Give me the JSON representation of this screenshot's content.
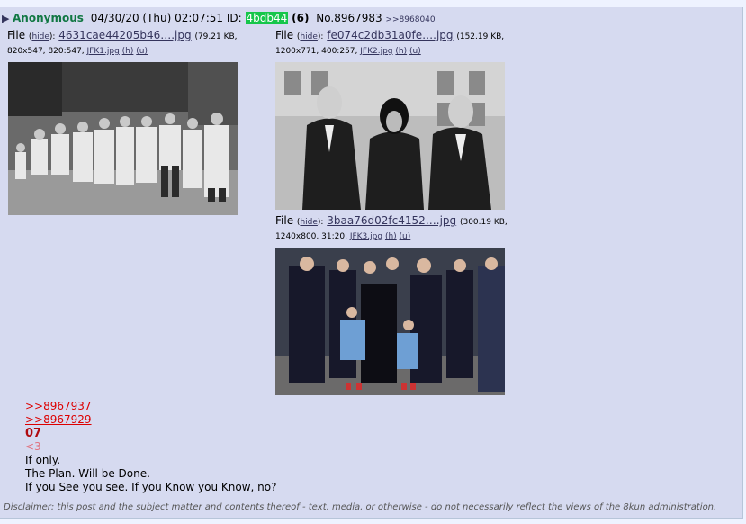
{
  "post": {
    "name": "Anonymous",
    "datetime": "04/30/20 (Thu) 02:07:51",
    "id_label": "ID:",
    "id": "4bdb44",
    "reply_count": "(6)",
    "post_number": "No.8967983",
    "backlink": ">>8968040"
  },
  "files": [
    {
      "label": "File",
      "hide": "hide",
      "filename": "4631cae44205b46….jpg",
      "size": "(79.21 KB,",
      "dims": "820x547, 820:547,",
      "orig": "JFK1.jpg",
      "h": "(h)",
      "u": "(u)"
    },
    {
      "label": "File",
      "hide": "hide",
      "filename": "fe074c2db31a0fe….jpg",
      "size": "(152.19 KB,",
      "dims": "1200x771, 400:257,",
      "orig": "JFK2.jpg",
      "h": "(h)",
      "u": "(u)"
    },
    {
      "label": "File",
      "hide": "hide",
      "filename": "3baa76d02fc4152….jpg",
      "size": "(300.19 KB,",
      "dims": "1240x800, 31:20,",
      "orig": "JFK3.jpg",
      "h": "(h)",
      "u": "(u)"
    }
  ],
  "body": {
    "quote1": ">>8967937",
    "quote2": ">>8967929",
    "heading": "07",
    "pink": "<3",
    "line1": "If only.",
    "line2": "The Plan. Will be Done.",
    "line3": "If you See you see. If you Know you Know, no?"
  },
  "disclaimer": "Disclaimer: this post and the subject matter and contents thereof - text, media, or otherwise - do not necessarily reflect the views of the 8kun administration.",
  "colors": {
    "name": "#117743",
    "id_bg": "#16c64a",
    "quote": "#dd0000",
    "heading": "#af0a0f",
    "link": "#34345c"
  },
  "icons": {
    "post_arrow": "triangle-right-icon"
  }
}
